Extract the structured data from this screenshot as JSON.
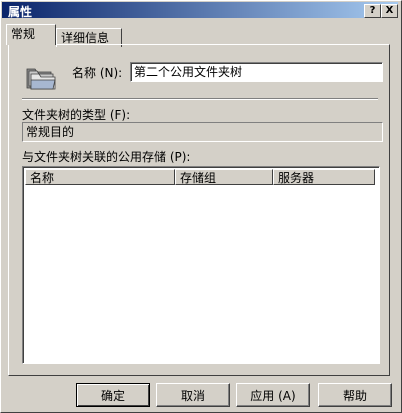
{
  "window": {
    "title": "属性",
    "help_glyph": "?",
    "close_glyph": "X"
  },
  "tabs": [
    {
      "label": "常规"
    },
    {
      "label": "详细信息"
    }
  ],
  "general": {
    "name_label": "名称 (N):",
    "name_value": "第二个公用文件夹树",
    "type_label": "文件夹树的类型 (F):",
    "type_value": "常规目的",
    "stores_label": "与文件夹树关联的公用存储 (P):",
    "columns": [
      "名称",
      "存储组",
      "服务器"
    ]
  },
  "buttons": {
    "ok": "确定",
    "cancel": "取消",
    "apply": "应用 (A)",
    "help": "帮助"
  }
}
